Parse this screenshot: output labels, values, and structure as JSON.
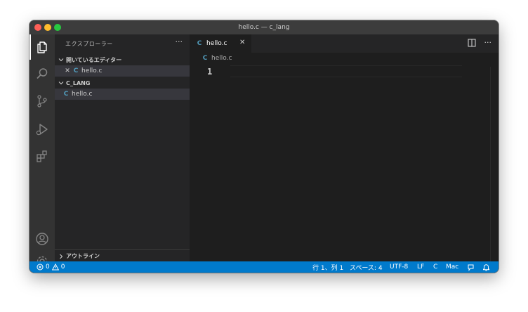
{
  "window": {
    "title": "hello.c — c_lang"
  },
  "activity_bar": {
    "items": [
      "files-icon",
      "search-icon",
      "source-control-icon",
      "run-debug-icon",
      "extensions-icon"
    ],
    "bottom_items": [
      "account-icon",
      "gear-icon"
    ]
  },
  "sidebar": {
    "title": "エクスプローラー",
    "more": "···",
    "open_editors": {
      "label": "開いているエディター",
      "files": [
        {
          "close": "✕",
          "icon": "C",
          "name": "hello.c"
        }
      ]
    },
    "folder": {
      "label": "C_LANG",
      "files": [
        {
          "icon": "C",
          "name": "hello.c"
        }
      ]
    },
    "outline": {
      "label": "アウトライン"
    }
  },
  "editor": {
    "tab": {
      "icon": "C",
      "label": "hello.c",
      "close": "✕"
    },
    "actions": {
      "more": "···"
    },
    "breadcrumb": {
      "icon": "C",
      "label": "hello.c"
    },
    "lines": [
      "1"
    ]
  },
  "status_bar": {
    "errors": "0",
    "warnings": "0",
    "position": "行 1、列 1",
    "spaces": "スペース: 4",
    "encoding": "UTF-8",
    "eol": "LF",
    "language": "C",
    "platform": "Mac"
  },
  "colors": {
    "accent": "#007acc",
    "c_icon": "#519aba",
    "sidebar_bg": "#252526",
    "editor_bg": "#1e1e1e",
    "activity_bg": "#333333"
  }
}
